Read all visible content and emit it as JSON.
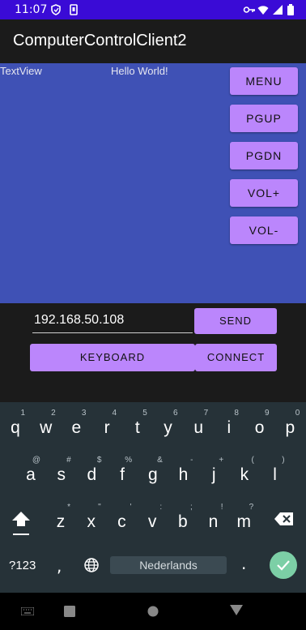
{
  "status_bar": {
    "time": "11:07",
    "icons": [
      "shield-icon",
      "sim-icon",
      "key-icon",
      "wifi-icon",
      "signal-icon",
      "battery-icon"
    ]
  },
  "app_bar": {
    "title": "ComputerControlClient2"
  },
  "content": {
    "textview_label": "TextView",
    "hello_label": "Hello World!",
    "side_buttons": [
      "MENU",
      "PGUP",
      "PGDN",
      "VOL+",
      "VOL-"
    ]
  },
  "controls": {
    "ip_value": "192.168.50.108",
    "send_label": "SEND",
    "keyboard_label": "KEYBOARD",
    "connect_label": "CONNECT"
  },
  "keyboard": {
    "row1": [
      {
        "k": "q",
        "h": "1"
      },
      {
        "k": "w",
        "h": "2"
      },
      {
        "k": "e",
        "h": "3"
      },
      {
        "k": "r",
        "h": "4"
      },
      {
        "k": "t",
        "h": "5"
      },
      {
        "k": "y",
        "h": "6"
      },
      {
        "k": "u",
        "h": "7"
      },
      {
        "k": "i",
        "h": "8"
      },
      {
        "k": "o",
        "h": "9"
      },
      {
        "k": "p",
        "h": "0"
      }
    ],
    "row2": [
      {
        "k": "a",
        "h": "@"
      },
      {
        "k": "s",
        "h": "#"
      },
      {
        "k": "d",
        "h": "$"
      },
      {
        "k": "f",
        "h": "%"
      },
      {
        "k": "g",
        "h": "&"
      },
      {
        "k": "h",
        "h": "-"
      },
      {
        "k": "j",
        "h": "+"
      },
      {
        "k": "k",
        "h": "("
      },
      {
        "k": "l",
        "h": ")"
      }
    ],
    "row3": [
      {
        "k": "z",
        "h": "*"
      },
      {
        "k": "x",
        "h": "\""
      },
      {
        "k": "c",
        "h": "'"
      },
      {
        "k": "v",
        "h": ":"
      },
      {
        "k": "b",
        "h": ";"
      },
      {
        "k": "n",
        "h": "!"
      },
      {
        "k": "m",
        "h": "?"
      }
    ],
    "symbols_label": "?123",
    "comma_label": ",",
    "space_label": "Nederlands",
    "period_label": "."
  },
  "colors": {
    "status_bar": "#3a0bd6",
    "panel_blue": "#3f51b5",
    "accent_purple": "#bb86fc",
    "keyboard_bg": "#263238",
    "enter_green": "#7ccfa6"
  }
}
